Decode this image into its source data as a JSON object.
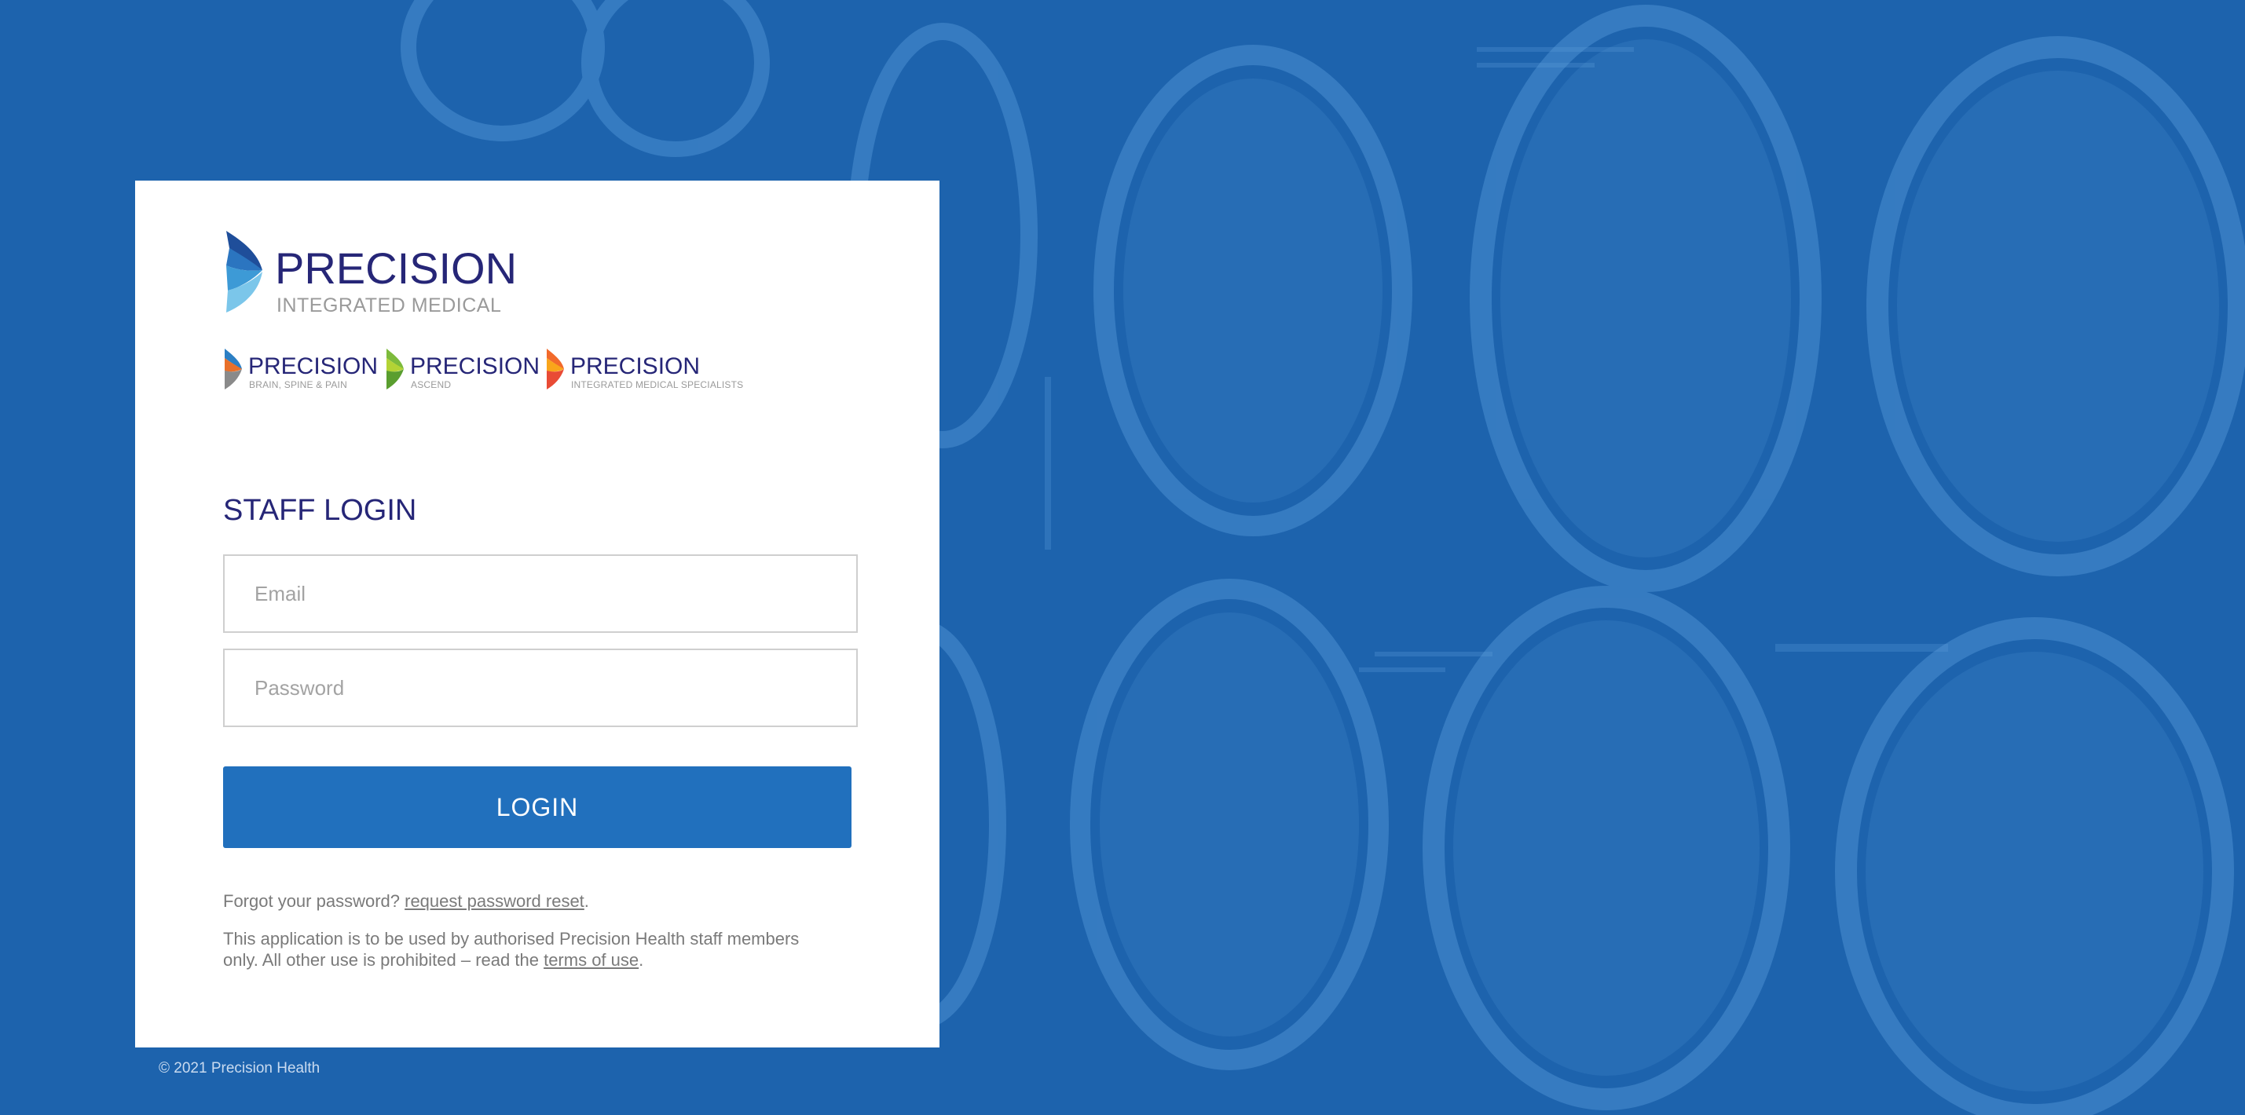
{
  "brand": {
    "name": "PRECISION",
    "subtitle": "INTEGRATED MEDICAL"
  },
  "sub_brands": [
    {
      "name": "PRECISION",
      "subtitle": "BRAIN, SPINE & PAIN",
      "colors": [
        "#2c7fc4",
        "#e8702a",
        "#8a8a8a"
      ]
    },
    {
      "name": "PRECISION",
      "subtitle": "ASCEND",
      "colors": [
        "#7dbb3c",
        "#b3d335",
        "#5a9e2f"
      ]
    },
    {
      "name": "PRECISION",
      "subtitle": "INTEGRATED MEDICAL SPECIALISTS",
      "colors": [
        "#f26a2b",
        "#f9a51b",
        "#e94b35"
      ]
    }
  ],
  "login": {
    "heading": "STAFF LOGIN",
    "email_placeholder": "Email",
    "password_placeholder": "Password",
    "button_label": "LOGIN",
    "forgot_text": "Forgot your password?",
    "reset_link": "request password reset",
    "forgot_end": ".",
    "notice_text": "This application is to be used by authorised Precision Health staff members only. All other use is prohibited – read the",
    "terms_link": "terms of use",
    "notice_end": "."
  },
  "footer": {
    "copyright": "© 2021 Precision Health"
  },
  "colors": {
    "background": "#1d63ad",
    "brand_navy": "#262677",
    "button": "#2170bd",
    "logo_blue_dark": "#1a4f9c",
    "logo_blue_light": "#3aa0d8"
  },
  "background_image": "brain-ct-scans"
}
